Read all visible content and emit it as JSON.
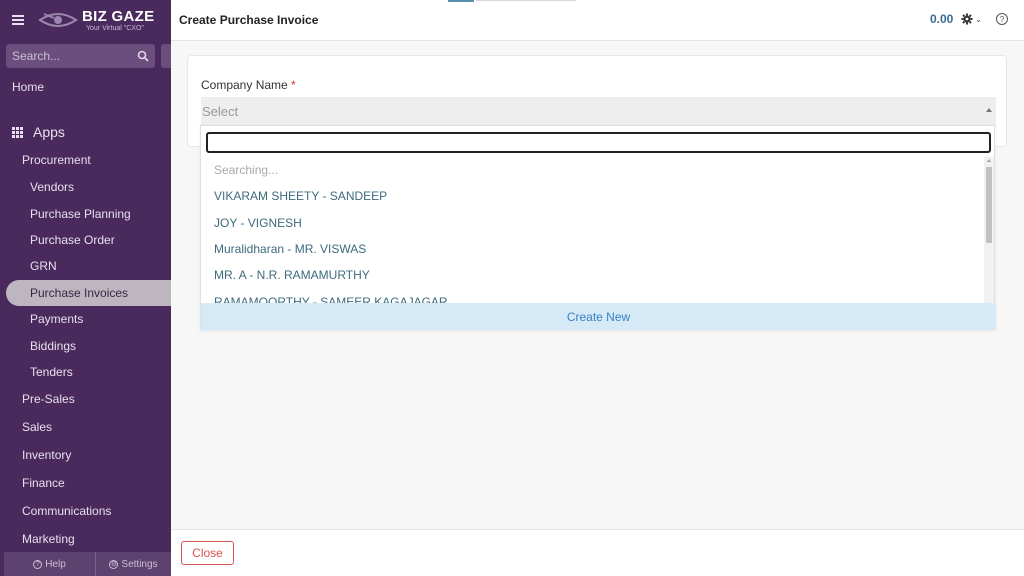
{
  "app": {
    "brand_name": "BIZ GAZE",
    "brand_tagline": "Your Virtual \"CXO\""
  },
  "sidebar": {
    "search_placeholder": "Search...",
    "home_label": "Home",
    "apps_label": "Apps",
    "groups": {
      "procurement": "Procurement",
      "pre_sales": "Pre-Sales",
      "sales": "Sales",
      "inventory": "Inventory",
      "finance": "Finance",
      "communications": "Communications",
      "marketing": "Marketing"
    },
    "procurement_items": [
      "Vendors",
      "Purchase Planning",
      "Purchase Order",
      "GRN",
      "Purchase Invoices",
      "Payments",
      "Biddings",
      "Tenders"
    ],
    "active_item": "Purchase Invoices",
    "footer": {
      "help_label": "Help",
      "settings_label": "Settings"
    }
  },
  "header": {
    "title": "Create Purchase Invoice",
    "amount": "0.00"
  },
  "form": {
    "company_label": "Company Name",
    "required_mark": "*",
    "select_placeholder": "Select"
  },
  "dropdown": {
    "search_value": "",
    "searching_text": "Searching...",
    "options": [
      "VIKARAM SHEETY - SANDEEP",
      "JOY - VIGNESH",
      "Muralidharan - MR. VISWAS",
      "MR. A - N.R. RAMAMURTHY",
      "RAMAMOORTHY - SAMEER KAGAJAGAR"
    ],
    "create_new_label": "Create New"
  },
  "footer": {
    "close_label": "Close"
  },
  "colors": {
    "sidebar_bg": "#4a2a5c",
    "amount": "#3a6a8f",
    "option_text": "#3d6b7d",
    "create_new_bg": "#d5e9f7",
    "close_red": "#d9534f"
  }
}
